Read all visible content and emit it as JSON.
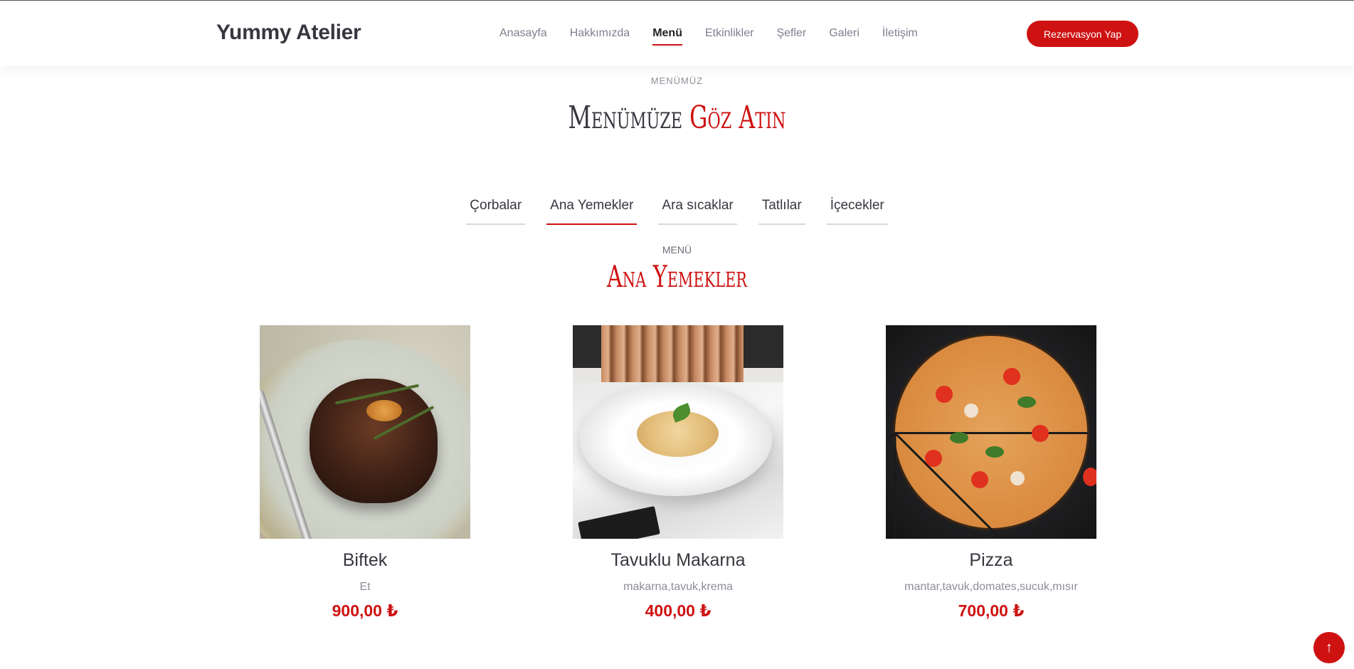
{
  "brand": {
    "logo": "Yummy Atelier"
  },
  "nav": {
    "items": [
      {
        "label": "Anasayfa"
      },
      {
        "label": "Hakkımızda"
      },
      {
        "label": "Menü"
      },
      {
        "label": "Etkinlikler"
      },
      {
        "label": "Şefler"
      },
      {
        "label": "Galeri"
      },
      {
        "label": "İletişim"
      }
    ],
    "active": "Menü",
    "cta_label": "Rezervasyon Yap"
  },
  "section": {
    "eyebrow": "MENÜMÜZ",
    "title_main": "Menümüze ",
    "title_accent": "Göz Atın"
  },
  "tabs": [
    {
      "label": "Çorbalar"
    },
    {
      "label": "Ana Yemekler"
    },
    {
      "label": "Ara sıcaklar"
    },
    {
      "label": "Tatlılar"
    },
    {
      "label": "İçecekler"
    }
  ],
  "active_tab": "Ana Yemekler",
  "menu": {
    "eyebrow": "MENÜ",
    "title": "Ana Yemekler",
    "items": [
      {
        "name": "Biftek",
        "ingredients": "Et",
        "price": "900,00 ₺",
        "image": "steak-photo"
      },
      {
        "name": "Tavuklu Makarna",
        "ingredients": "makarna,tavuk,krema",
        "price": "400,00 ₺",
        "image": "pasta-photo"
      },
      {
        "name": "Pizza",
        "ingredients": "mantar,tavuk,domates,sucuk,mısır",
        "price": "700,00 ₺",
        "image": "pizza-photo"
      }
    ]
  },
  "scroll_top": {
    "icon": "arrow-up-icon",
    "glyph": "↑"
  },
  "colors": {
    "accent": "#ce1212",
    "text": "#37373f",
    "muted": "#7f7f90"
  }
}
